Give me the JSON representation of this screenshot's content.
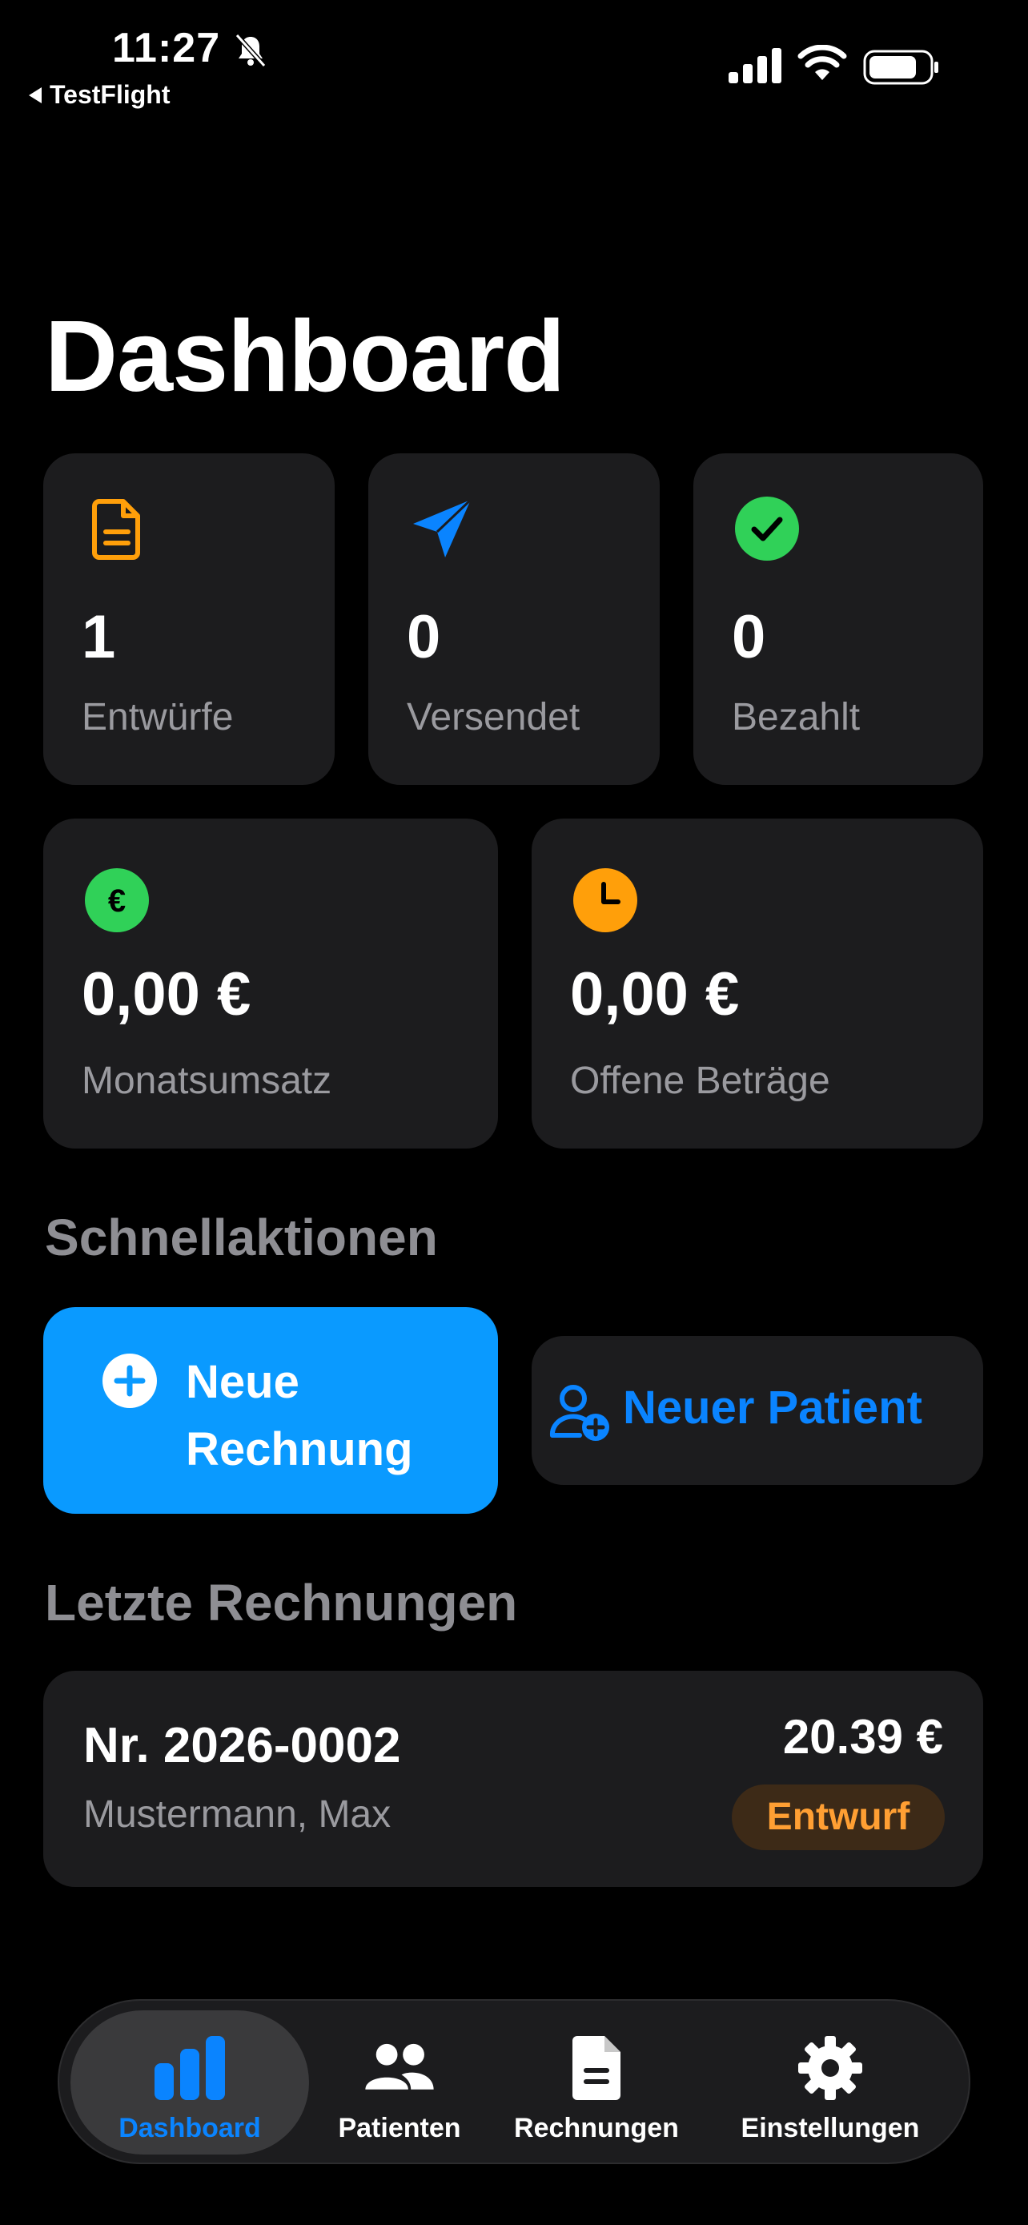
{
  "status_bar": {
    "time": "11:27",
    "back_label": "TestFlight"
  },
  "header": {
    "title": "Dashboard"
  },
  "stats": {
    "drafts": {
      "value": "1",
      "label": "Entwürfe",
      "icon": "document-icon",
      "color": "#ff9f0a"
    },
    "sent": {
      "value": "0",
      "label": "Versendet",
      "icon": "paper-plane-icon",
      "color": "#0a84ff"
    },
    "paid": {
      "value": "0",
      "label": "Bezahlt",
      "icon": "checkmark-circle-icon",
      "color": "#30d158"
    },
    "monthly_revenue": {
      "value": "0,00 €",
      "label": "Monatsumsatz",
      "icon": "euro-circle-icon",
      "color": "#30d158"
    },
    "open_amounts": {
      "value": "0,00 €",
      "label": "Offene Beträge",
      "icon": "clock-circle-icon",
      "color": "#ff9f0a"
    }
  },
  "quick_actions": {
    "title": "Schnellaktionen",
    "new_invoice": "Neue Rechnung",
    "new_patient": "Neuer Patient"
  },
  "recent_invoices": {
    "title": "Letzte Rechnungen",
    "items": [
      {
        "number": "Nr. 2026-0002",
        "patient": "Mustermann, Max",
        "amount": "20.39 €",
        "status": "Entwurf"
      }
    ]
  },
  "tab_bar": {
    "active": "Dashboard",
    "tabs": [
      {
        "label": "Dashboard",
        "icon": "bar-chart-icon"
      },
      {
        "label": "Patienten",
        "icon": "people-icon"
      },
      {
        "label": "Rechnungen",
        "icon": "document-icon"
      },
      {
        "label": "Einstellungen",
        "icon": "gear-icon"
      }
    ]
  },
  "colors": {
    "accent": "#0a84ff",
    "primary_button": "#0a9aff",
    "card_bg": "#1c1c1e",
    "badge_text": "#ff9f33",
    "badge_bg": "#3d2a17"
  }
}
